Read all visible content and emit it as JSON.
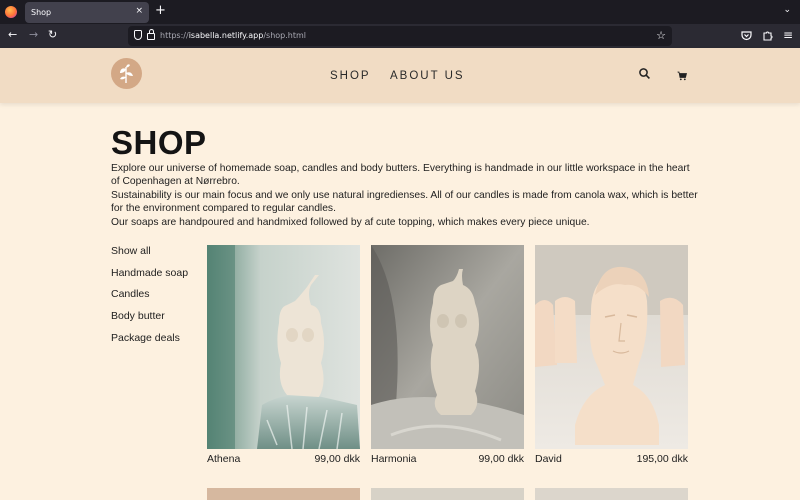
{
  "browser": {
    "tab_title": "Shop",
    "tab_close": "×",
    "new_tab": "+",
    "url_prefix": "https://",
    "url_host": "isabella.netlify.app",
    "url_path": "/shop.html",
    "icons": [
      "back-icon",
      "forward-icon",
      "reload-icon",
      "shield-icon",
      "lock-icon",
      "star-icon",
      "pocket-icon",
      "extensions-icon",
      "menu-icon"
    ]
  },
  "site": {
    "menu": [
      "SHOP",
      "ABOUT US"
    ],
    "icons": [
      "search-icon",
      "cart-icon"
    ],
    "colors": {
      "header": "#f1dcc4",
      "background": "#fdf1e0",
      "logo": "#d3a886"
    }
  },
  "main": {
    "title": "SHOP",
    "intro": [
      "Explore our universe of homemade soap, candles and body butters. Everything is handmade in our little workspace in the heart of Copenhagen at Nørrebro.",
      "Sustainability is our main focus and we only use natural ingredienses. All of our candles is made from canola wax, which is better for the environment compared to regular candles.",
      "Our soaps are handpoured and handmixed followed by af cute topping, which makes every piece unique."
    ],
    "filters": [
      "Show all",
      "Handmade soap",
      "Candles",
      "Body butter",
      "Package deals"
    ],
    "products": [
      {
        "name": "Athena",
        "price": "99,00 dkk"
      },
      {
        "name": "Harmonia",
        "price": "99,00 dkk"
      },
      {
        "name": "David",
        "price": "195,00 dkk"
      }
    ]
  }
}
